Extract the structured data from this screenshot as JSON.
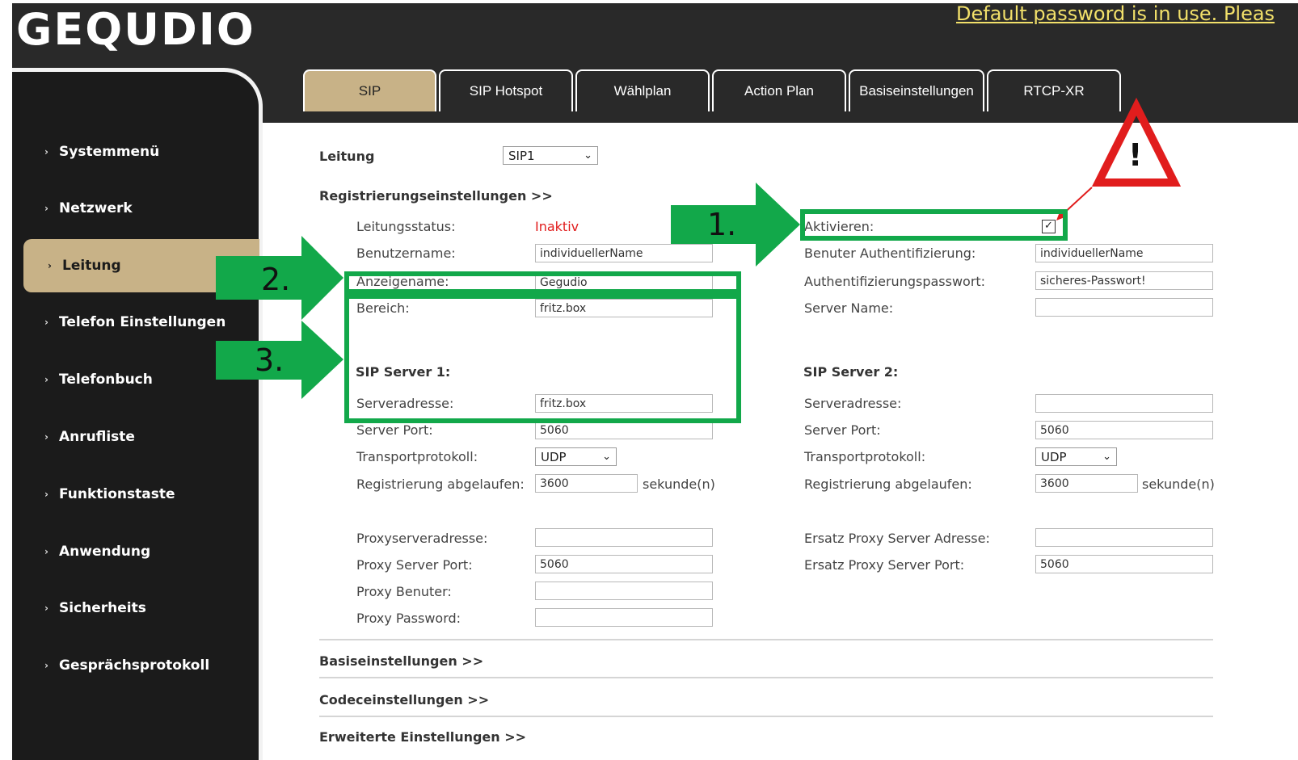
{
  "header": {
    "logo": "GEQUDIO",
    "warning": "Default password is in use. Pleas"
  },
  "sidebar": {
    "items": [
      {
        "label": "Systemmenü"
      },
      {
        "label": "Netzwerk"
      },
      {
        "label": "Leitung",
        "active": true
      },
      {
        "label": "Telefon Einstellungen"
      },
      {
        "label": "Telefonbuch"
      },
      {
        "label": "Anrufliste"
      },
      {
        "label": "Funktionstaste"
      },
      {
        "label": "Anwendung"
      },
      {
        "label": "Sicherheits"
      },
      {
        "label": "Gesprächsprotokoll"
      }
    ]
  },
  "tabs": [
    {
      "label": "SIP",
      "active": true
    },
    {
      "label": "SIP Hotspot"
    },
    {
      "label": "Wählplan"
    },
    {
      "label": "Action Plan"
    },
    {
      "label": "Basiseinstellungen"
    },
    {
      "label": "RTCP-XR"
    }
  ],
  "form": {
    "line_label": "Leitung",
    "line_value": "SIP1",
    "section_registration": "Registrierungseinstellungen >>",
    "line_status_label": "Leitungsstatus:",
    "line_status_value": "Inaktiv",
    "username_label": "Benutzername:",
    "username_value": "individuellerName",
    "display_name_label": "Anzeigename:",
    "display_name_value": "Gegudio",
    "realm_label": "Bereich:",
    "realm_value": "fritz.box",
    "activate_label": "Aktivieren:",
    "activate_checked": true,
    "auth_user_label": "Benuter Authentifizierung:",
    "auth_user_value": "individuellerName",
    "auth_password_label": "Authentifizierungspasswort:",
    "auth_password_value": "sicheres-Passwort!",
    "server_name_label": "Server Name:",
    "server_name_value": "",
    "sip1": {
      "title": "SIP Server 1:",
      "address_label": "Serveradresse:",
      "address_value": "fritz.box",
      "port_label": "Server Port:",
      "port_value": "5060",
      "transport_label": "Transportprotokoll:",
      "transport_value": "UDP",
      "expire_label": "Registrierung abgelaufen:",
      "expire_value": "3600",
      "unit": "sekunde(n)"
    },
    "sip2": {
      "title": "SIP Server 2:",
      "address_label": "Serveradresse:",
      "address_value": "",
      "port_label": "Server Port:",
      "port_value": "5060",
      "transport_label": "Transportprotokoll:",
      "transport_value": "UDP",
      "expire_label": "Registrierung abgelaufen:",
      "expire_value": "3600",
      "unit": "sekunde(n)"
    },
    "proxy_address_label": "Proxyserveradresse:",
    "proxy_address_value": "",
    "proxy_port_label": "Proxy Server Port:",
    "proxy_port_value": "5060",
    "proxy_user_label": "Proxy Benuter:",
    "proxy_user_value": "",
    "proxy_password_label": "Proxy Password:",
    "proxy_password_value": "",
    "backup_proxy_address_label": "Ersatz Proxy Server Adresse:",
    "backup_proxy_address_value": "",
    "backup_proxy_port_label": "Ersatz Proxy Server Port:",
    "backup_proxy_port_value": "5060",
    "section_basic": "Basiseinstellungen >>",
    "section_codec": "Codeceinstellungen >>",
    "section_advanced": "Erweiterte Einstellungen >>"
  },
  "annotations": {
    "step1": "1.",
    "step2": "2.",
    "step3": "3.",
    "warning_symbol": "!",
    "accent_color": "#12a84a",
    "warning_color": "#e11d1d"
  }
}
